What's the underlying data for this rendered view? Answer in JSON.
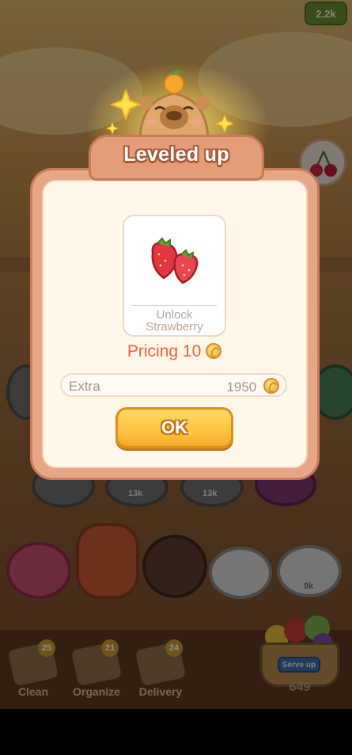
{
  "header": {
    "coins_display": "2.2k"
  },
  "background_plates": {
    "labels": [
      "13k",
      "13k",
      "9k"
    ]
  },
  "bottom_bar": {
    "tools": [
      {
        "label": "Clean",
        "badge": "25"
      },
      {
        "label": "Organize",
        "badge": "21"
      },
      {
        "label": "Delivery",
        "badge": "24"
      }
    ],
    "serve_button": "Serve up",
    "serve_count": "649"
  },
  "dialog": {
    "title": "Leveled up",
    "unlock_line1": "Unlock",
    "unlock_line2": "Strawberry",
    "pricing_label": "Pricing 10",
    "extra_label": "Extra",
    "extra_value": "1950",
    "ok_label": "OK"
  },
  "icons": [
    "capybara-mascot-icon",
    "sparkle-star-icon",
    "cherry-icon",
    "strawberry-icon",
    "coin-icon",
    "mop-icon",
    "glove-icon",
    "broom-icon",
    "fruit-basket-icon"
  ],
  "colors": {
    "title_text": "#ffffff",
    "pricing_text": "#e0633f",
    "ok_button": "#ffc43f",
    "dialog_frame": "#e7a784"
  }
}
